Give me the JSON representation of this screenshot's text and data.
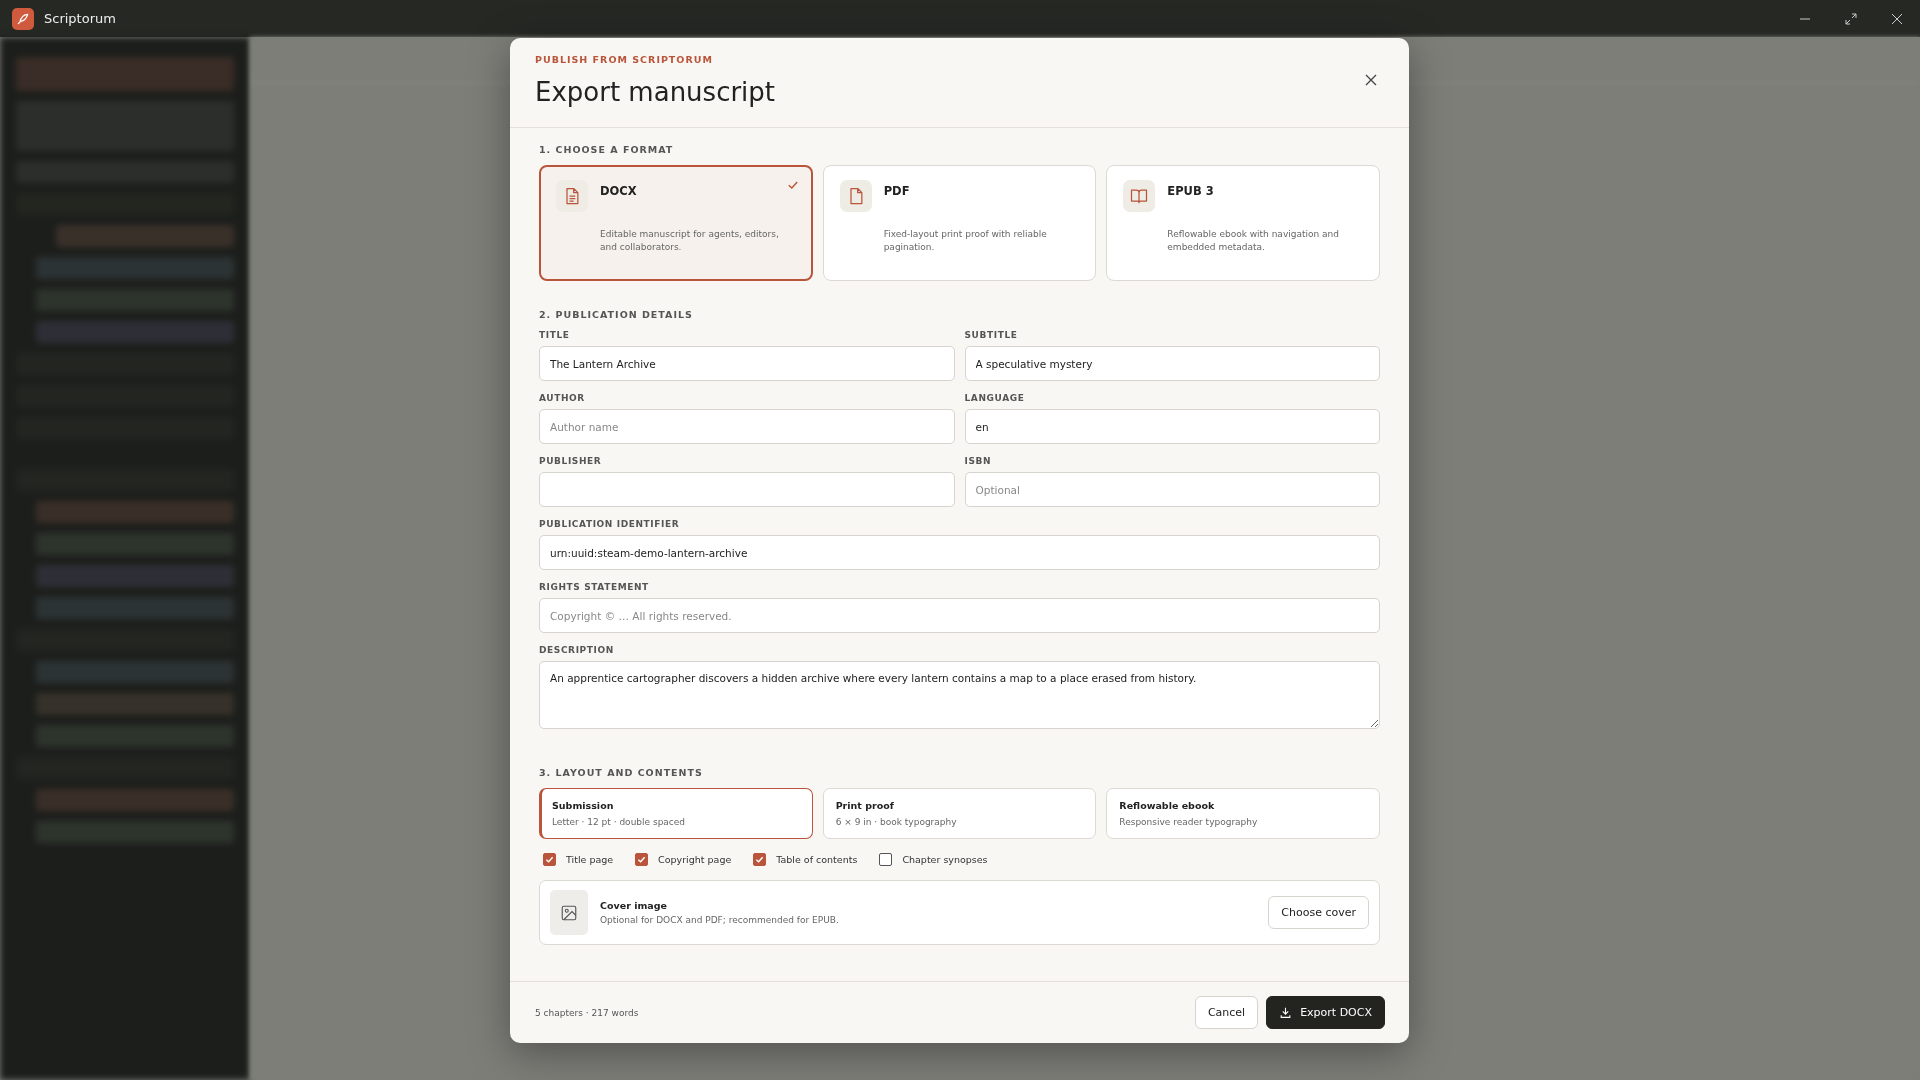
{
  "window": {
    "title": "Scriptorum"
  },
  "dialog": {
    "eyebrow": "PUBLISH FROM SCRIPTORUM",
    "title": "Export manuscript",
    "format_section": "1. CHOOSE A FORMAT",
    "formats": [
      {
        "kind": "document",
        "name": "DOCX",
        "description": "Editable manuscript for agents, editors, and collaborators.",
        "selected": true
      },
      {
        "kind": "file",
        "name": "PDF",
        "description": "Fixed-layout print proof with reliable pagination.",
        "selected": false
      },
      {
        "kind": "book",
        "name": "EPUB 3",
        "description": "Reflowable ebook with navigation and embedded metadata.",
        "selected": false
      }
    ],
    "details_section": "2. PUBLICATION DETAILS",
    "field_rows": [
      {
        "fields": [
          {
            "kind": "text",
            "label": "TITLE",
            "value": "The Lantern Archive"
          },
          {
            "kind": "text",
            "label": "SUBTITLE",
            "value": "A speculative mystery"
          }
        ]
      },
      {
        "fields": [
          {
            "kind": "text",
            "label": "AUTHOR",
            "placeholder": "Author name"
          },
          {
            "kind": "text",
            "label": "LANGUAGE",
            "value": "en"
          }
        ]
      },
      {
        "fields": [
          {
            "kind": "text",
            "label": "PUBLISHER"
          },
          {
            "kind": "text",
            "label": "ISBN",
            "placeholder": "Optional"
          }
        ]
      },
      {
        "fields": [
          {
            "kind": "text",
            "label": "PUBLICATION IDENTIFIER",
            "value": "urn:uuid:steam-demo-lantern-archive"
          }
        ]
      },
      {
        "fields": [
          {
            "kind": "text",
            "label": "RIGHTS STATEMENT",
            "placeholder": "Copyright © … All rights reserved."
          }
        ]
      },
      {
        "fields": [
          {
            "kind": "textarea",
            "label": "DESCRIPTION",
            "value": "An apprentice cartographer discovers a hidden archive where every lantern contains a map to a place erased from history."
          }
        ]
      }
    ],
    "layout_section": "3. LAYOUT AND CONTENTS",
    "layouts": [
      {
        "name": "Submission",
        "description": "Letter · 12 pt · double spaced",
        "selected": true
      },
      {
        "name": "Print proof",
        "description": "6 × 9 in · book typography",
        "selected": false
      },
      {
        "name": "Reflowable ebook",
        "description": "Responsive reader typography",
        "selected": false
      }
    ],
    "options": [
      {
        "label": "Title page",
        "checked": true
      },
      {
        "label": "Copyright page",
        "checked": true
      },
      {
        "label": "Table of contents",
        "checked": true
      },
      {
        "label": "Chapter synopses",
        "checked": false
      }
    ],
    "cover": {
      "title": "Cover image",
      "description": "Optional for DOCX and PDF; recommended for EPUB.",
      "button": "Choose cover"
    },
    "footer": {
      "summary": "5 chapters · 217 words",
      "cancel": "Cancel",
      "export": "Export DOCX"
    }
  }
}
